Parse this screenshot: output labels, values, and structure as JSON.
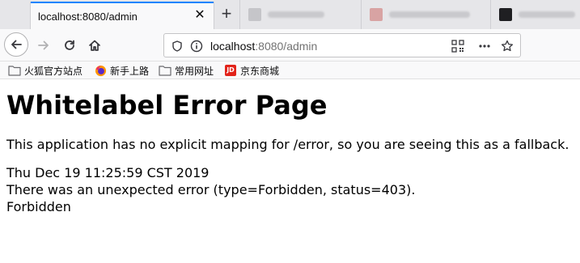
{
  "browser": {
    "active_tab": {
      "title": "localhost:8080/admin"
    },
    "urlbar": {
      "host": "localhost",
      "rest": ":8080/admin"
    },
    "bookmarks": [
      {
        "label": "火狐官方站点",
        "icon": "folder-icon"
      },
      {
        "label": "新手上路",
        "icon": "firefox-icon"
      },
      {
        "label": "常用网址",
        "icon": "folder-icon"
      },
      {
        "label": "京东商城",
        "icon": "jd-icon",
        "icon_text": "JD"
      }
    ]
  },
  "page": {
    "title": "Whitelabel Error Page",
    "message": "This application has no explicit mapping for /error, so you are seeing this as a fallback.",
    "timestamp": "Thu Dec 19 11:25:59 CST 2019",
    "error_line": "There was an unexpected error (type=Forbidden, status=403).",
    "status_text": "Forbidden"
  },
  "colors": {
    "accent": "#0a84ff",
    "jd_red": "#e2231a",
    "tab_strip": "#e6e6e9",
    "toolbar": "#f9f9fa"
  }
}
